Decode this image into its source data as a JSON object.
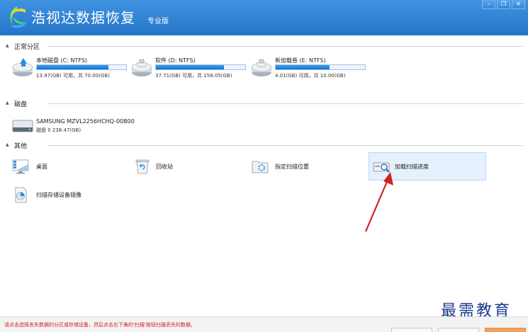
{
  "app": {
    "title": "浩视达数据恢复",
    "edition": "专业版"
  },
  "window_buttons": {
    "minimize": "–",
    "restore": "❐",
    "close": "✕"
  },
  "sections": {
    "partitions": "正常分区",
    "disks": "磁盘",
    "others": "其他"
  },
  "partitions": [
    {
      "name": "本地磁盘 (C: NTFS)",
      "size": "13.97(GB) 可用，共 70.00(GB)",
      "used_fraction": 0.8
    },
    {
      "name": "软件 (D: NTFS)",
      "size": "37.71(GB) 可用，共 158.05(GB)",
      "used_fraction": 0.76
    },
    {
      "name": "新加载卷 (E: NTFS)",
      "size": "4.01(GB) 可用，共 10.00(GB)",
      "used_fraction": 0.6
    }
  ],
  "disk": {
    "name": "SAMSUNG MZVL2256HCHQ-00B00",
    "info": "磁盘 0    238.47(GB)"
  },
  "others": [
    {
      "label": "桌面",
      "icon": "desktop-icon"
    },
    {
      "label": "回收站",
      "icon": "recycle-bin-icon"
    },
    {
      "label": "指定扫描位置",
      "icon": "folder-scan-icon"
    },
    {
      "label": "加载扫描进度",
      "icon": "load-scan-icon"
    },
    {
      "label": "扫描存储设备镜像",
      "icon": "disk-image-icon"
    }
  ],
  "status": {
    "message": "请点击选择丢失数据的分区或存储设备，然后点击右下角的'扫描'按钮扫描丢失的数据。"
  },
  "watermark": "最需教育",
  "colors": {
    "title_bar": "#2f84d6",
    "usage_fill": "#1f86e0",
    "highlight": "#e5f1fc",
    "status_text": "#d21f1f",
    "arrow": "#d62020"
  }
}
